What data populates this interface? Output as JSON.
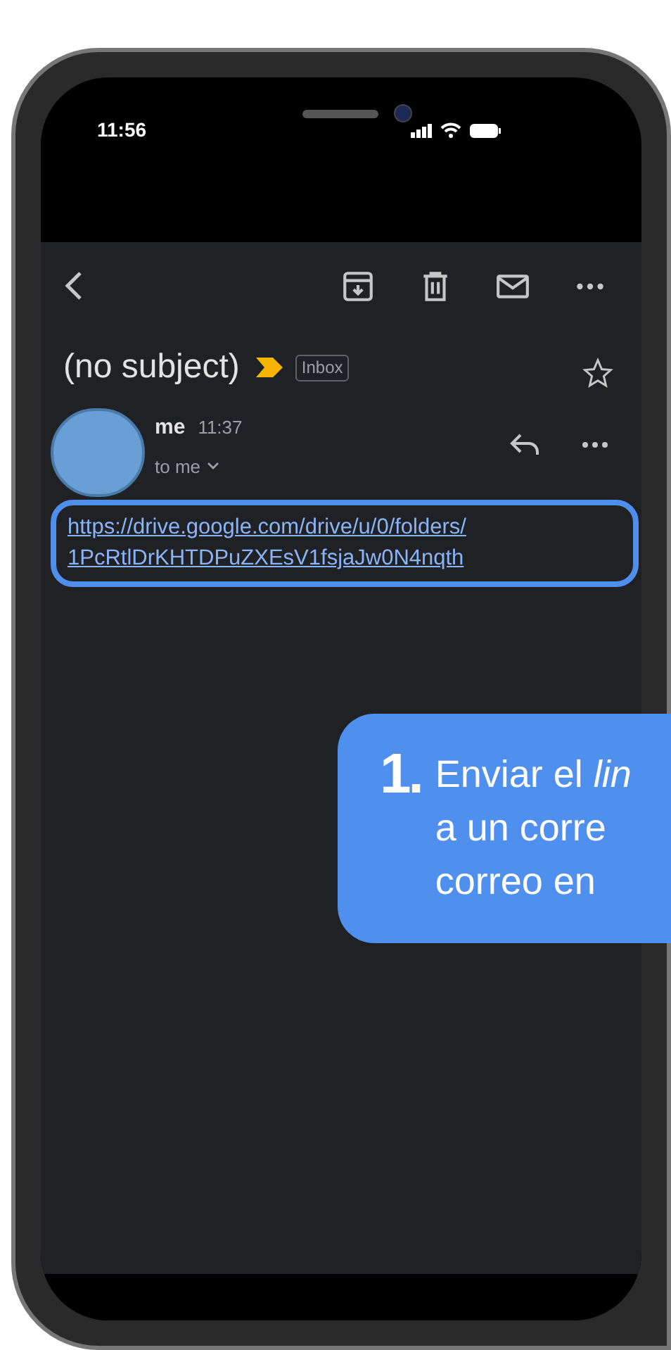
{
  "status_bar": {
    "time": "11:56"
  },
  "subject": {
    "title": "(no subject)",
    "label": "Inbox",
    "important": true,
    "starred": false
  },
  "message": {
    "sender": "me",
    "time": "11:37",
    "recipient": "to me",
    "body_link": "https://drive.google.com/drive/u/0/folders/1PcRtlDrKHTDPuZXEsV1fsjaJw0N4nqth"
  },
  "callout": {
    "number": "1.",
    "lines": [
      "Enviar el *lin*",
      "a un corre",
      "correo en"
    ]
  }
}
